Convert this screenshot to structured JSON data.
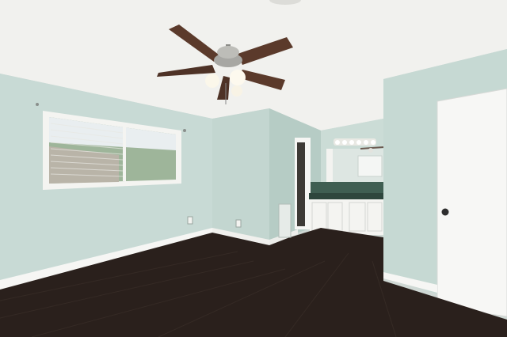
{
  "scene": {
    "colors": {
      "ceiling": "#f2f2ef",
      "wall_left": "#c9dbd6",
      "wall_mid": "#bfd3cd",
      "wall_right": "#c5d8d2",
      "floor": "#2a211d",
      "trim": "#f6f6f4",
      "door": "#f7f7f5",
      "fan_blade": "#5a3a2c",
      "vanity_top": "#2f4a3f"
    },
    "icons": [
      "ceiling-fan-icon",
      "window-icon",
      "door-icon",
      "vanity-icon",
      "mirror-icon",
      "vent-icon",
      "outlet-icon"
    ]
  }
}
